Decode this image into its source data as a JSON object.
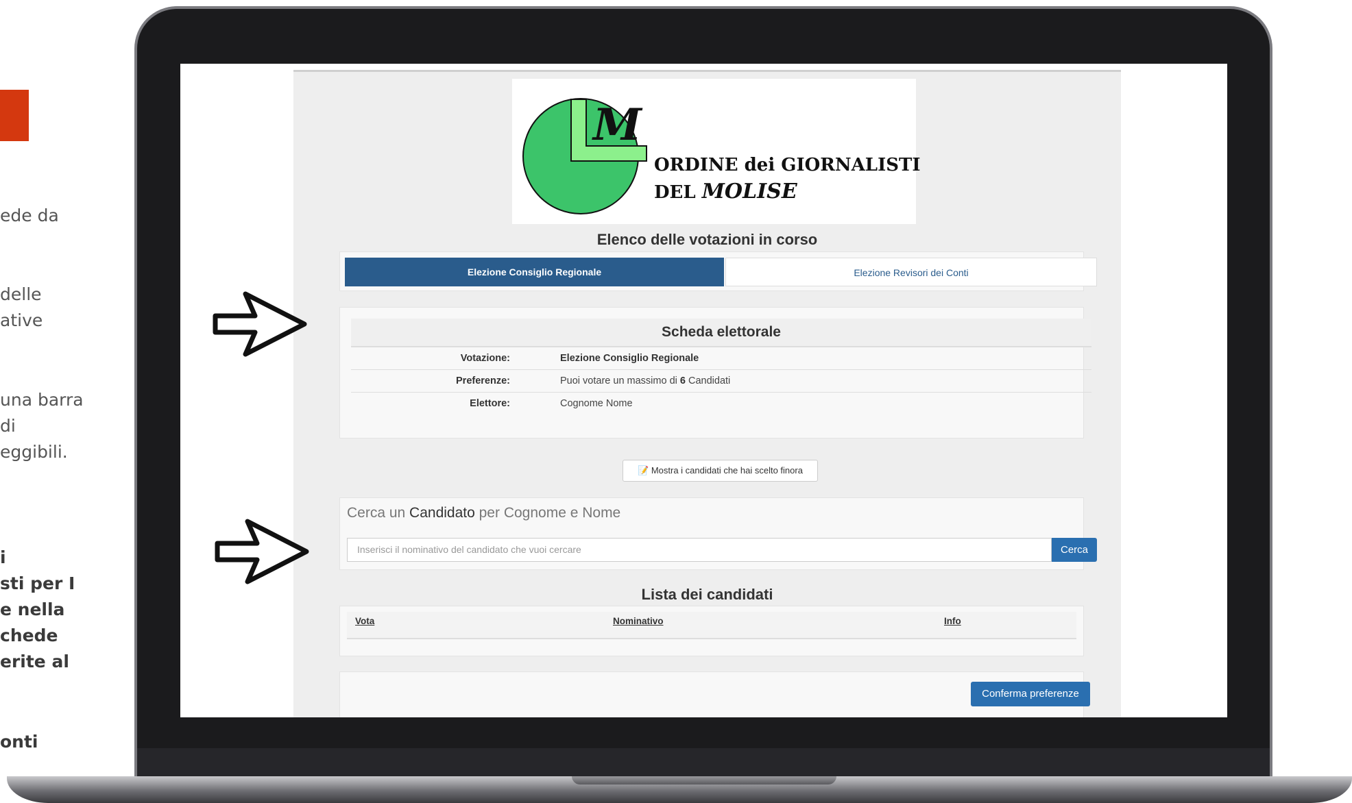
{
  "side": {
    "lines1": [
      "ede da"
    ],
    "lines2": [
      "delle",
      "ative"
    ],
    "lines3": [
      "una barra",
      " di",
      "eggibili."
    ],
    "lines4": [
      "i",
      "sti per I",
      "e nella",
      "chede",
      "erite al"
    ],
    "lines5": [
      "onti"
    ]
  },
  "logo": {
    "letter": "M",
    "line1": "ORDINE dei GIORNALISTI",
    "line2_prefix": "DEL ",
    "line2_italic": "MOLISE"
  },
  "votazioni": {
    "heading": "Elenco delle votazioni in corso",
    "tabs": [
      {
        "label": "Elezione Consiglio Regionale",
        "active": true
      },
      {
        "label": "Elezione Revisori dei Conti",
        "active": false
      }
    ]
  },
  "scheda": {
    "title": "Scheda elettorale",
    "votazione_label": "Votazione:",
    "votazione_value": "Elezione Consiglio Regionale",
    "preferenze_label": "Preferenze:",
    "preferenze_prefix": "Puoi votare un massimo di ",
    "preferenze_count": "6",
    "preferenze_suffix": " Candidati",
    "elettore_label": "Elettore:",
    "elettore_value": "Cognome Nome"
  },
  "show_button": "📝 Mostra i candidati che hai scelto finora",
  "search": {
    "title_prefix": "Cerca un ",
    "title_bold": "Candidato",
    "title_suffix": " per Cognome e Nome",
    "placeholder": "Inserisci il nominativo del candidato che vuoi cercare",
    "button": "Cerca"
  },
  "lista": {
    "heading": "Lista dei candidati",
    "columns": [
      "Vota",
      "Nominativo",
      "Info"
    ]
  },
  "confirm_button": "Conferma preferenze",
  "colors": {
    "accent": "#2a5c8c",
    "button": "#2a6fb0",
    "orange": "#d4380f",
    "logo_green": "#3cc46a",
    "logo_light_green": "#8cf08c"
  }
}
